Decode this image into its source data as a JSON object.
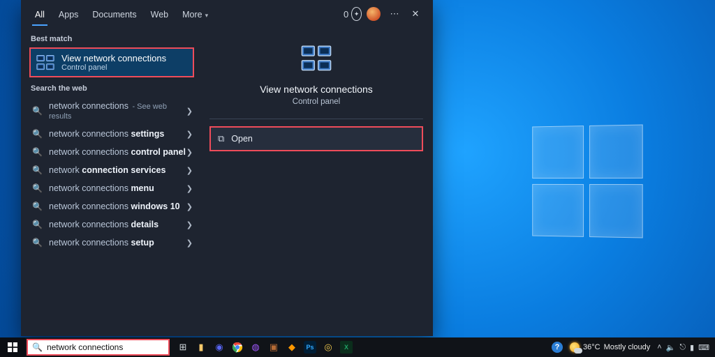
{
  "tabs": {
    "all": "All",
    "apps": "Apps",
    "documents": "Documents",
    "web": "Web",
    "more": "More"
  },
  "header": {
    "rewards_points": "0"
  },
  "left": {
    "best_match_label": "Best match",
    "best_match": {
      "title": "View network connections",
      "subtitle": "Control panel"
    },
    "search_the_web_label": "Search the web",
    "items": [
      {
        "pre": "network connections",
        "bold": "",
        "hint": "See web results"
      },
      {
        "pre": "network connections ",
        "bold": "settings",
        "hint": ""
      },
      {
        "pre": "network connections ",
        "bold": "control panel",
        "hint": ""
      },
      {
        "pre": "network ",
        "bold": "connection services",
        "hint": ""
      },
      {
        "pre": "network connections ",
        "bold": "menu",
        "hint": ""
      },
      {
        "pre": "network connections ",
        "bold": "windows 10",
        "hint": ""
      },
      {
        "pre": "network connections ",
        "bold": "details",
        "hint": ""
      },
      {
        "pre": "network connections ",
        "bold": "setup",
        "hint": ""
      }
    ]
  },
  "right": {
    "title": "View network connections",
    "subtitle": "Control panel",
    "action_open": "Open"
  },
  "taskbar": {
    "search_query": "network connections",
    "weather_temp": "36°C",
    "weather_text": "Mostly cloudy"
  }
}
